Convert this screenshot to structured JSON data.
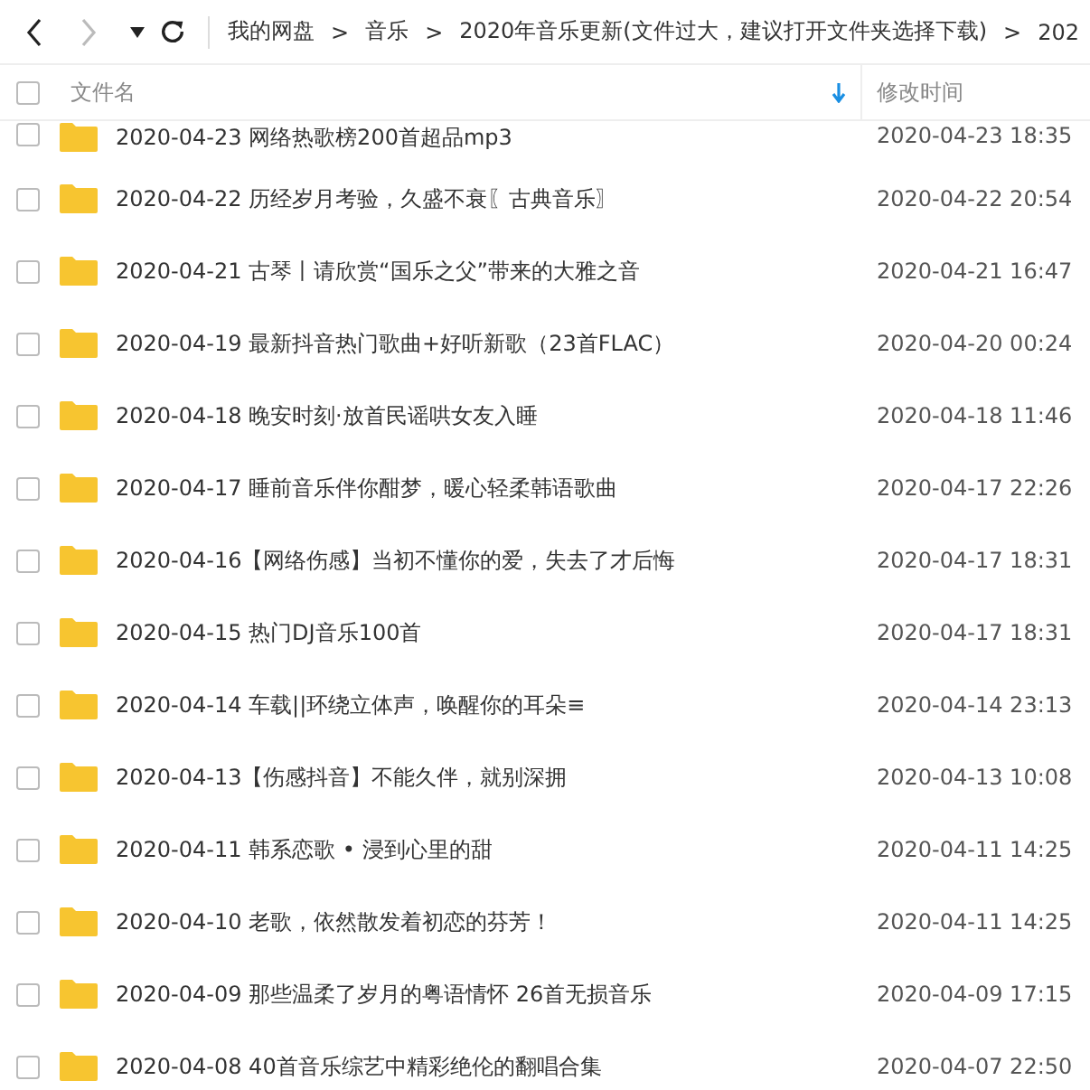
{
  "nav": {
    "back": {
      "disabled": false
    },
    "forward": {
      "disabled": true
    }
  },
  "breadcrumb": [
    {
      "kind": "crumb",
      "text": "我的网盘"
    },
    {
      "kind": "separator",
      "text": ">"
    },
    {
      "kind": "crumb",
      "text": "音乐"
    },
    {
      "kind": "separator",
      "text": ">"
    },
    {
      "kind": "crumb",
      "text": "2020年音乐更新(文件过大，建议打开文件夹选择下载)"
    },
    {
      "kind": "separator",
      "text": ">"
    },
    {
      "kind": "crumb",
      "text": "202"
    }
  ],
  "columns": {
    "name": "文件名",
    "modified": "修改时间",
    "select_all": {
      "checked": false
    }
  },
  "rows": [
    {
      "name": "2020-04-23 网络热歌榜200首超品mp3",
      "modified": "2020-04-23 18:35",
      "checked": false
    },
    {
      "name": "2020-04-22 历经岁月考验，久盛不衰〖古典音乐〗",
      "modified": "2020-04-22 20:54",
      "checked": false
    },
    {
      "name": "2020-04-21 古琴丨请欣赏“国乐之父”带来的大雅之音",
      "modified": "2020-04-21 16:47",
      "checked": false
    },
    {
      "name": "2020-04-19 最新抖音热门歌曲+好听新歌（23首FLAC）",
      "modified": "2020-04-20 00:24",
      "checked": false
    },
    {
      "name": "2020-04-18 晚安时刻·放首民谣哄女友入睡",
      "modified": "2020-04-18 11:46",
      "checked": false
    },
    {
      "name": "2020-04-17 睡前音乐伴你酣梦，暖心轻柔韩语歌曲",
      "modified": "2020-04-17 22:26",
      "checked": false
    },
    {
      "name": "2020-04-16【网络伤感】当初不懂你的爱，失去了才后悔",
      "modified": "2020-04-17 18:31",
      "checked": false
    },
    {
      "name": "2020-04-15 热门DJ音乐100首",
      "modified": "2020-04-17 18:31",
      "checked": false
    },
    {
      "name": "2020-04-14 车载||环绕立体声，唤醒你的耳朵≡",
      "modified": "2020-04-14 23:13",
      "checked": false
    },
    {
      "name": "2020-04-13【伤感抖音】不能久伴，就别深拥",
      "modified": "2020-04-13 10:08",
      "checked": false
    },
    {
      "name": "2020-04-11 韩系恋歌 • 浸到心里的甜",
      "modified": "2020-04-11 14:25",
      "checked": false
    },
    {
      "name": "2020-04-10 老歌，依然散发着初恋的芬芳！",
      "modified": "2020-04-11 14:25",
      "checked": false
    },
    {
      "name": "2020-04-09 那些温柔了岁月的粤语情怀 26首无损音乐",
      "modified": "2020-04-09 17:15",
      "checked": false
    },
    {
      "name": "2020-04-08 40首音乐综艺中精彩绝伦的翻唱合集",
      "modified": "2020-04-07 22:50",
      "checked": false
    }
  ]
}
